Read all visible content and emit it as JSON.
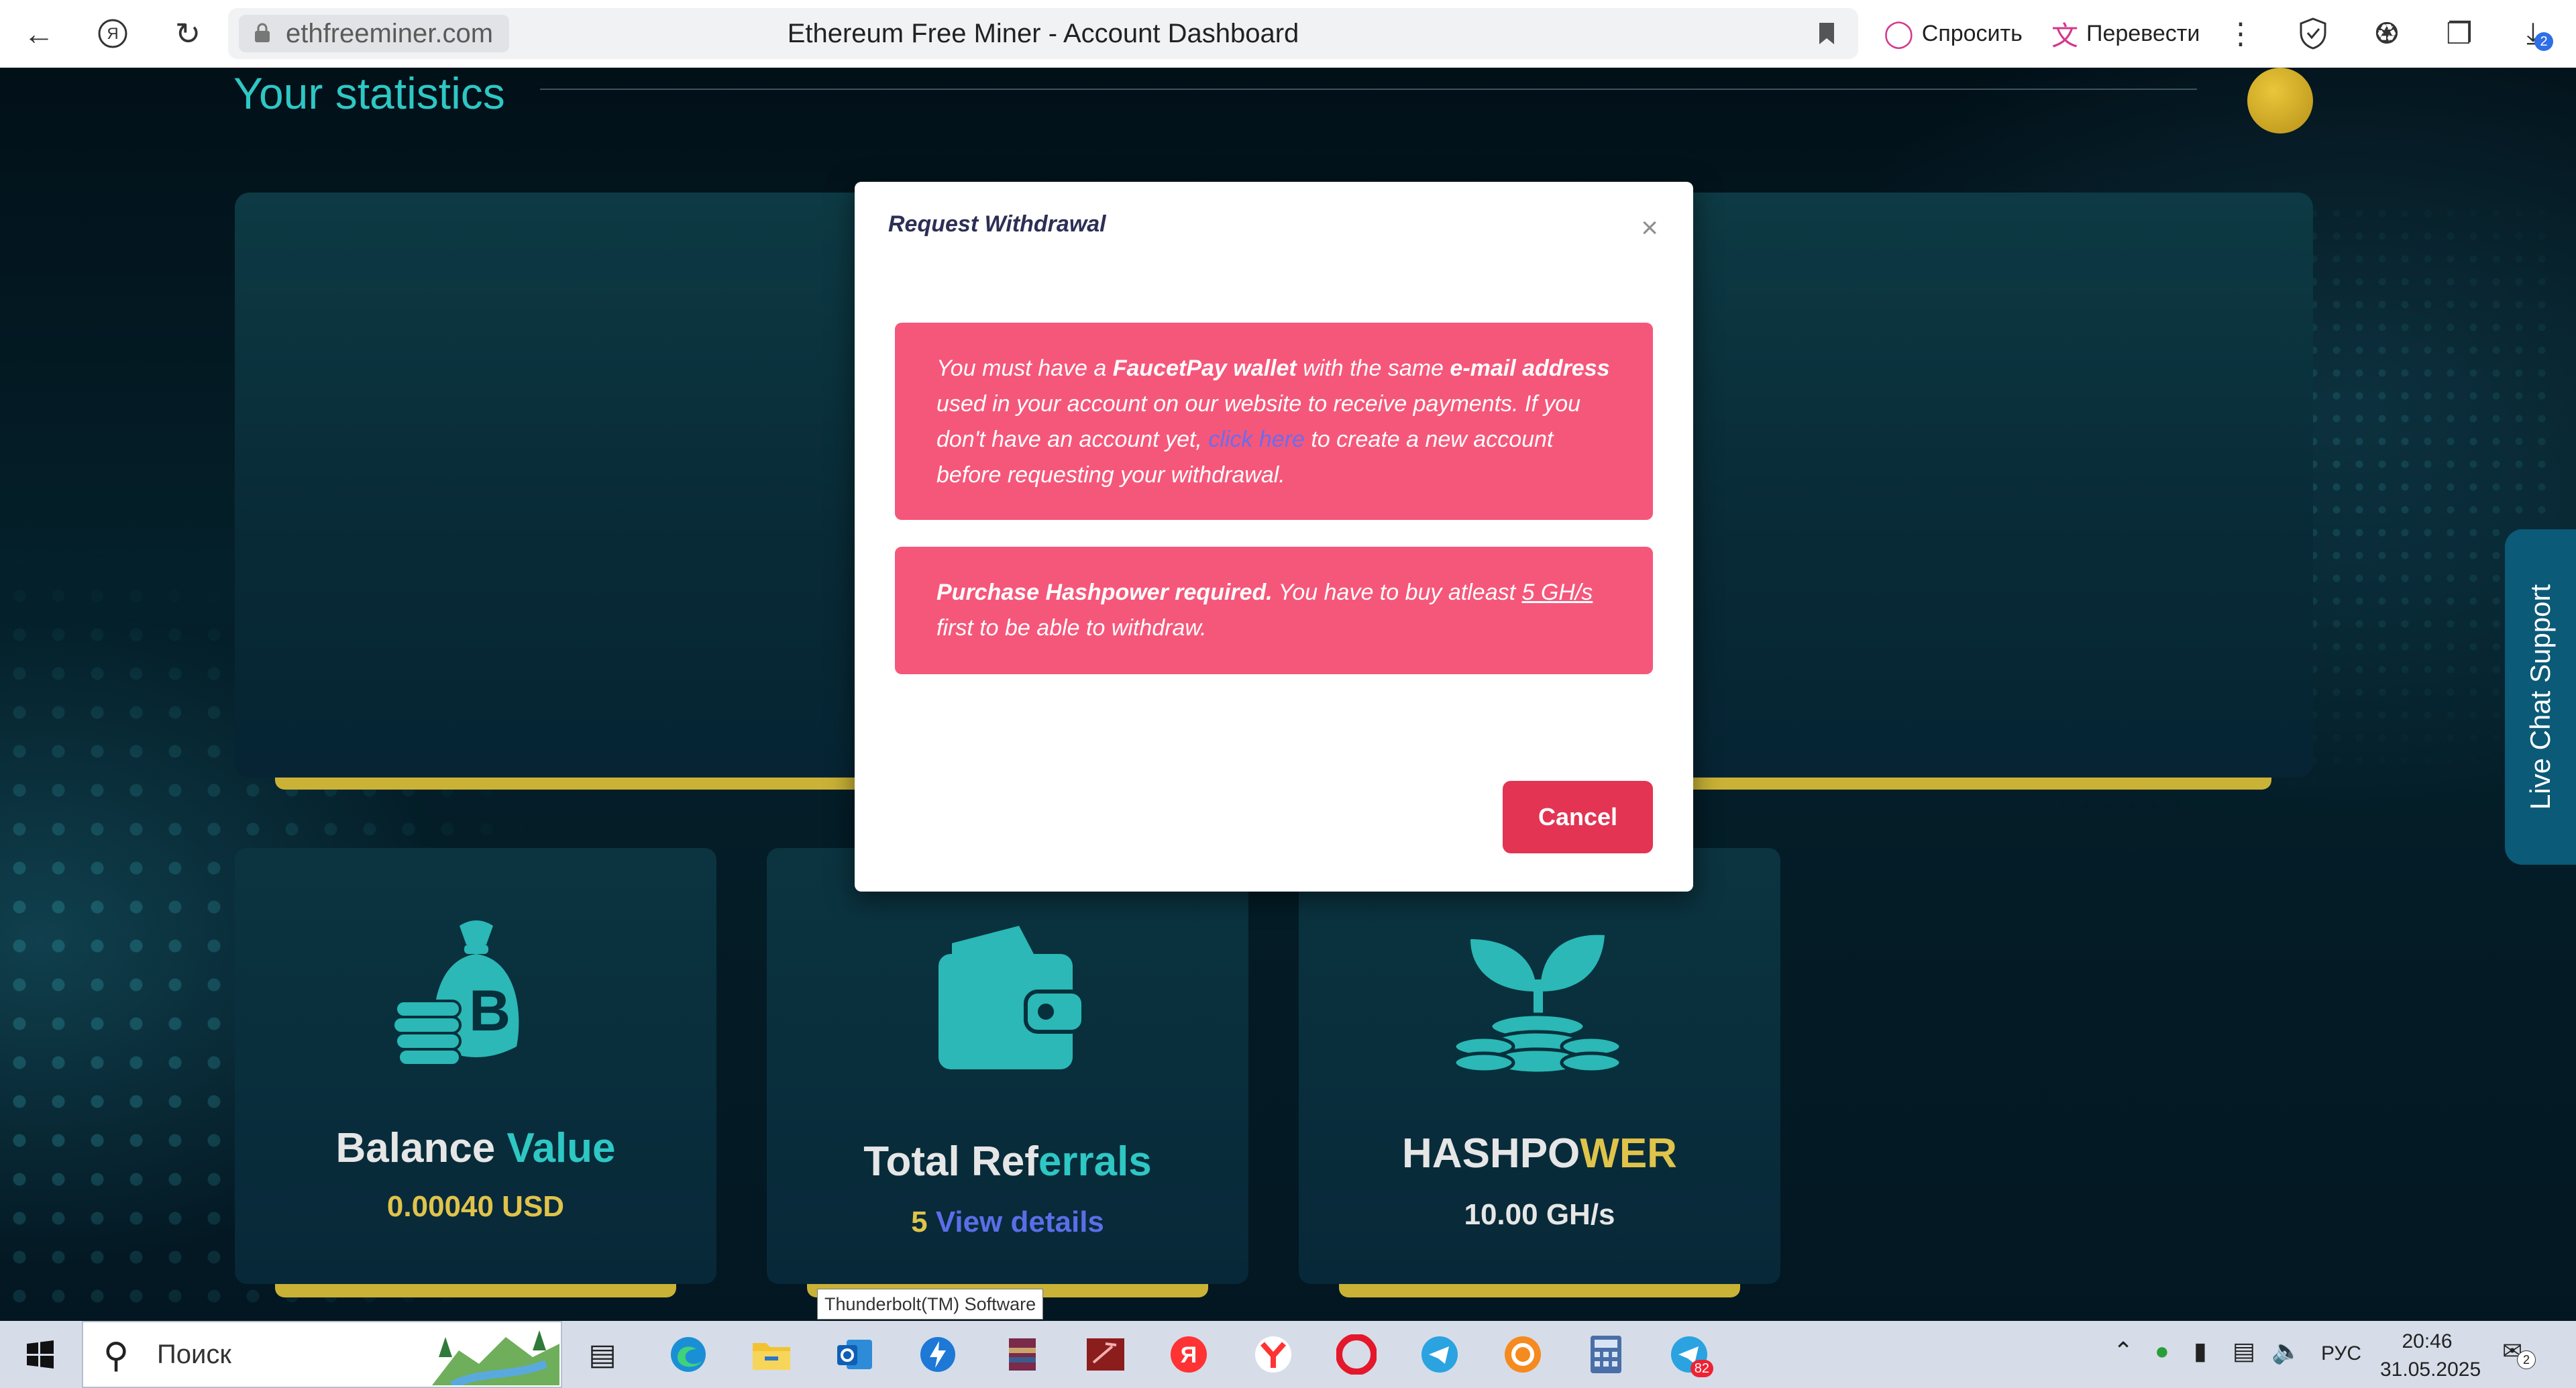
{
  "browser": {
    "url": "ethfreeminer.com",
    "title": "Ethereum Free Miner - Account Dashboard",
    "ask_label": "Спросить",
    "translate_label": "Перевести",
    "downloads_badge": "2"
  },
  "page": {
    "section_title": "Your statistics",
    "cards": [
      {
        "title_white": "Balance ",
        "title_accent": "Value",
        "value": "0.00040 USD",
        "accent": "#2ec7c4"
      },
      {
        "title_white": "Total Ref",
        "title_accent": "errals",
        "value_count": "5",
        "value_link": "View details",
        "accent": "#2ec7c4"
      },
      {
        "title_white": "HASHPO",
        "title_accent": "WER",
        "value": "10.00 GH/s",
        "accent": "#e0c34a"
      }
    ],
    "live_chat": "Live Chat Support"
  },
  "modal": {
    "title": "Request Withdrawal",
    "close": "×",
    "alert1": {
      "p1": "You must have a ",
      "b1": "FaucetPay wallet",
      "p2": " with the same ",
      "b2": "e-mail address",
      "p3": " used in your account on our website to receive payments. If you don't have an account yet, ",
      "link": "click here",
      "p4": " to create a new account before requesting your withdrawal."
    },
    "alert2": {
      "b1": "Purchase Hashpower required.",
      "p1": " You have to buy atleast ",
      "u1": "5 GH/s",
      "p2": " first to be able to withdraw."
    },
    "cancel": "Cancel"
  },
  "tooltip": "Thunderbolt(TM) Software",
  "taskbar": {
    "search_label": "Поиск",
    "lang": "РУС",
    "time": "20:46",
    "date": "31.05.2025",
    "telegram_badge": "82",
    "notif_badge": "2"
  },
  "colors": {
    "teal": "#2ec7c4",
    "gold": "#c9b236",
    "alert_pink": "#f5577a",
    "cancel_red": "#e33453"
  }
}
